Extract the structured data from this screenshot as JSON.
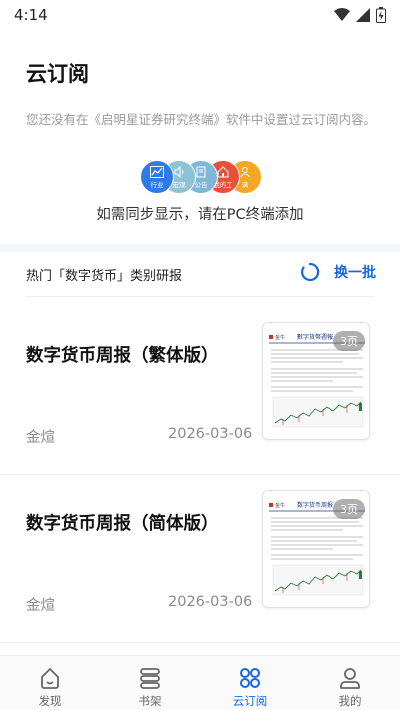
{
  "status": {
    "time": "4:14"
  },
  "header": {
    "title": "云订阅",
    "notice": "您还没有在《启明星证券研究终端》软件中设置过云订阅内容。"
  },
  "cluster": {
    "items": [
      {
        "label": "行业",
        "color": "#2f7be6",
        "icon": "chart-icon"
      },
      {
        "label": "宏观",
        "color": "#8ec3d6",
        "icon": "speaker-icon"
      },
      {
        "label": "公告",
        "color": "#7fb7d9",
        "icon": "document-icon"
      },
      {
        "label": "我的工",
        "color": "#e8503a",
        "icon": "house-icon"
      },
      {
        "label": "满",
        "color": "#f5a623",
        "icon": "person-icon"
      }
    ],
    "sync_text": "如需同步显示，请在PC终端添加"
  },
  "hot": {
    "label": "热门「数字货币」类别研报",
    "refresh_label": "换一批"
  },
  "reports": [
    {
      "title": "数字货币周报（繁体版）",
      "author": "金煊",
      "date": "2026-03-06",
      "pages": "3页",
      "thumb_heading": "數字貨幣週報",
      "thumb_logo": "金牛"
    },
    {
      "title": "数字货币周报（简体版）",
      "author": "金煊",
      "date": "2026-03-06",
      "pages": "3页",
      "thumb_heading": "数字货币周报",
      "thumb_logo": "金牛"
    }
  ],
  "nav": {
    "items": [
      {
        "label": "发现",
        "icon": "discover-icon"
      },
      {
        "label": "书架",
        "icon": "bookshelf-icon"
      },
      {
        "label": "云订阅",
        "icon": "grid-icon",
        "active": true
      },
      {
        "label": "我的",
        "icon": "profile-icon"
      }
    ]
  },
  "colors": {
    "accent": "#1769e0",
    "refresh_ring": "#1769e0"
  }
}
